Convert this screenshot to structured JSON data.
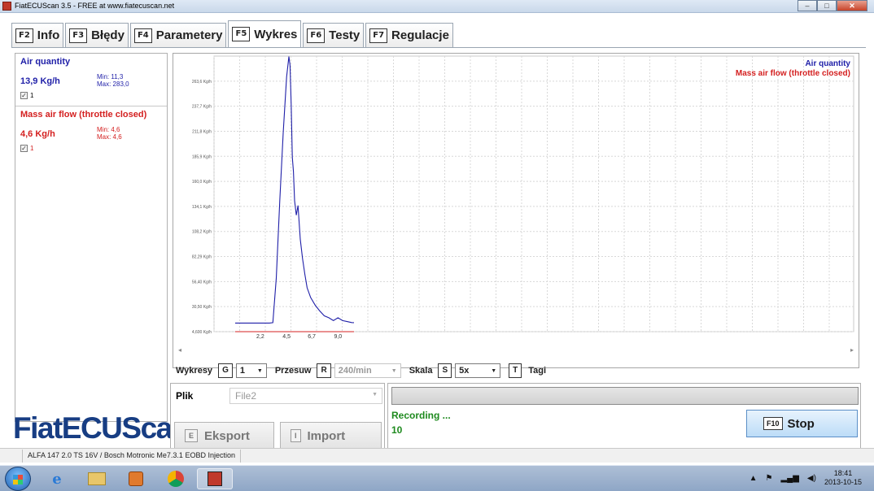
{
  "window": {
    "title": "FiatECUScan 3.5 - FREE at www.fiatecuscan.net",
    "minimize": "–",
    "maximize": "□",
    "close": "✕"
  },
  "tabs": [
    {
      "key": "F2",
      "label": "Info"
    },
    {
      "key": "F3",
      "label": "Błędy"
    },
    {
      "key": "F4",
      "label": "Parametery"
    },
    {
      "key": "F5",
      "label": "Wykres"
    },
    {
      "key": "F6",
      "label": "Testy"
    },
    {
      "key": "F7",
      "label": "Regulacje"
    }
  ],
  "active_tab": "Wykres",
  "parameters": [
    {
      "name": "Air quantity",
      "value": "13,9 Kg/h",
      "min": "Min: 11,3",
      "max": "Max: 283,0",
      "check_label": "1",
      "color": "#1f1fa8"
    },
    {
      "name": "Mass air flow (throttle closed)",
      "value": "4,6 Kg/h",
      "min": "Min: 4,6",
      "max": "Max: 4,6",
      "check_label": "1",
      "color": "#d42020"
    }
  ],
  "logo": "FiatECUScan",
  "chart_data": {
    "type": "line",
    "y_ticks": [
      "4,600 Kg/h",
      "30,50 Kg/h",
      "56,40 Kg/h",
      "82,29 Kg/h",
      "108,2 Kg/h",
      "134,1 Kg/h",
      "160,0 Kg/h",
      "185,9 Kg/h",
      "211,8 Kg/h",
      "237,7 Kg/h",
      "263,6 Kg/h"
    ],
    "x_ticks": [
      "2,2",
      "4,5",
      "6,7",
      "9,0"
    ],
    "x_tick_values": [
      2.2,
      4.5,
      6.7,
      9.0
    ],
    "xlim": [
      0,
      10.4
    ],
    "ylim": [
      4.6,
      289.5
    ],
    "grid": true,
    "legend_position": "top-right",
    "series": [
      {
        "name": "Air quantity",
        "color": "#1f1fa8",
        "x": [
          0,
          0.8,
          1.6,
          2.4,
          3.0,
          3.3,
          3.6,
          3.9,
          4.2,
          4.5,
          4.7,
          4.8,
          4.9,
          5.0,
          5.1,
          5.2,
          5.35,
          5.5,
          5.7,
          5.9,
          6.1,
          6.3,
          6.6,
          7.0,
          7.4,
          7.8,
          8.2,
          8.6,
          9.0,
          9.4,
          9.8,
          10.2,
          10.4
        ],
        "y": [
          13.5,
          13.5,
          13.5,
          13.5,
          13.5,
          13.9,
          60,
          140,
          210,
          268,
          289,
          280,
          240,
          185,
          170,
          140,
          125,
          135,
          100,
          80,
          64,
          50,
          40,
          32,
          26,
          21,
          19,
          16,
          19,
          16,
          15,
          14,
          13.9
        ]
      },
      {
        "name": "Mass air flow (throttle closed)",
        "color": "#d42020",
        "x": [
          0,
          10.4
        ],
        "y": [
          4.6,
          4.6
        ]
      }
    ]
  },
  "controls": {
    "wykresy_label": "Wykresy",
    "wykresy_key": "G",
    "wykresy_value": "1",
    "przesuw_label": "Przesuw",
    "przesuw_key": "R",
    "przesuw_value": "240/min",
    "skala_label": "Skala",
    "skala_key": "S",
    "skala_value": "5x",
    "tagi_key": "T",
    "tagi_label": "Tagi"
  },
  "file_panel": {
    "plik_label": "Plik",
    "file_value": "File2",
    "eksport_key": "E",
    "eksport_label": "Eksport",
    "import_key": "I",
    "import_label": "Import"
  },
  "status_panel": {
    "status_text": "Recording ...",
    "count": "10",
    "stop_key": "F10",
    "stop_label": "Stop"
  },
  "vehicle": "ALFA 147 2.0 TS 16V / Bosch Motronic Me7.3.1 EOBD Injection",
  "taskbar": {
    "time": "18:41",
    "date": "2013-10-15"
  }
}
